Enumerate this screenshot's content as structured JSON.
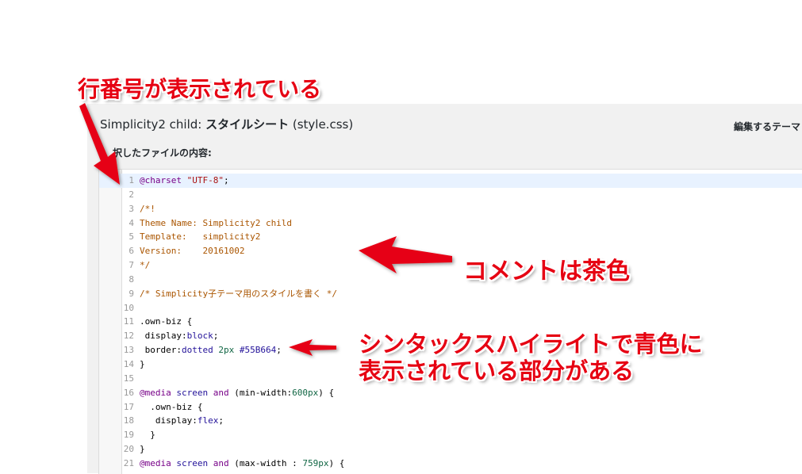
{
  "header": {
    "file_title_prefix": "Simplicity2 child: ",
    "file_title_bold": "スタイルシート",
    "file_title_suffix": " (style.css)",
    "theme_select_label": "編集するテーマ",
    "file_content_label": "択したファイルの内容:"
  },
  "editor": {
    "lines": [
      {
        "n": "1",
        "t": [
          [
            "kw",
            "@charset"
          ],
          [
            "",
            "",
            " "
          ],
          [
            "str",
            "\"UTF-8\""
          ],
          [
            "",
            ";"
          ]
        ]
      },
      {
        "n": "2",
        "t": []
      },
      {
        "n": "3",
        "t": [
          [
            "cm",
            "/*!"
          ]
        ]
      },
      {
        "n": "4",
        "t": [
          [
            "cm",
            "Theme Name: Simplicity2 child"
          ]
        ]
      },
      {
        "n": "5",
        "t": [
          [
            "cm",
            "Template:   simplicity2"
          ]
        ]
      },
      {
        "n": "6",
        "t": [
          [
            "cm",
            "Version:    20161002"
          ]
        ]
      },
      {
        "n": "7",
        "t": [
          [
            "cm",
            "*/"
          ]
        ]
      },
      {
        "n": "8",
        "t": []
      },
      {
        "n": "9",
        "t": [
          [
            "cm",
            "/* Simplicity子テーマ用のスタイルを書く */"
          ]
        ]
      },
      {
        "n": "10",
        "t": []
      },
      {
        "n": "11",
        "t": [
          [
            "",
            ".own-biz {"
          ]
        ]
      },
      {
        "n": "12",
        "t": [
          [
            "prop",
            " display"
          ],
          [
            "",
            ":"
          ],
          [
            "atom",
            "block"
          ],
          [
            "",
            ";"
          ]
        ]
      },
      {
        "n": "13",
        "t": [
          [
            "prop",
            " border"
          ],
          [
            "",
            ":"
          ],
          [
            "atom",
            "dotted"
          ],
          [
            "",
            " "
          ],
          [
            "num",
            "2px"
          ],
          [
            "",
            " "
          ],
          [
            "atom",
            "#55B664"
          ],
          [
            "",
            ";"
          ]
        ]
      },
      {
        "n": "14",
        "t": [
          [
            "",
            "}"
          ]
        ]
      },
      {
        "n": "15",
        "t": []
      },
      {
        "n": "16",
        "t": [
          [
            "kw",
            "@media"
          ],
          [
            "",
            " "
          ],
          [
            "atom",
            "screen"
          ],
          [
            "",
            " "
          ],
          [
            "kw",
            "and"
          ],
          [
            "",
            " ("
          ],
          [
            "prop",
            "min-width"
          ],
          [
            "",
            ":"
          ],
          [
            "num",
            "600px"
          ],
          [
            "",
            ") {"
          ]
        ]
      },
      {
        "n": "17",
        "t": [
          [
            "",
            "  .own-biz {"
          ]
        ]
      },
      {
        "n": "18",
        "t": [
          [
            "prop",
            "   display"
          ],
          [
            "",
            ":"
          ],
          [
            "atom",
            "flex"
          ],
          [
            "",
            ";"
          ]
        ]
      },
      {
        "n": "19",
        "t": [
          [
            "",
            "  }"
          ]
        ]
      },
      {
        "n": "20",
        "t": [
          [
            "",
            "}"
          ]
        ]
      },
      {
        "n": "21",
        "t": [
          [
            "kw",
            "@media"
          ],
          [
            "",
            " "
          ],
          [
            "atom",
            "screen"
          ],
          [
            "",
            " "
          ],
          [
            "kw",
            "and"
          ],
          [
            "",
            " ("
          ],
          [
            "prop",
            "max-width"
          ],
          [
            "",
            " : "
          ],
          [
            "num",
            "759px"
          ],
          [
            "",
            ") {"
          ]
        ]
      }
    ]
  },
  "annotations": {
    "line_numbers": "行番号が表示されている",
    "comment_brown": "コメントは茶色",
    "syntax_blue_1": "シンタックスハイライトで青色に",
    "syntax_blue_2": "表示されている部分がある"
  },
  "colors": {
    "annotation": "#e60012",
    "comment": "#aa5500",
    "keyword": "#770088",
    "string": "#aa1111",
    "atom": "#221199",
    "number": "#116644",
    "active_line": "#e8f2ff"
  }
}
